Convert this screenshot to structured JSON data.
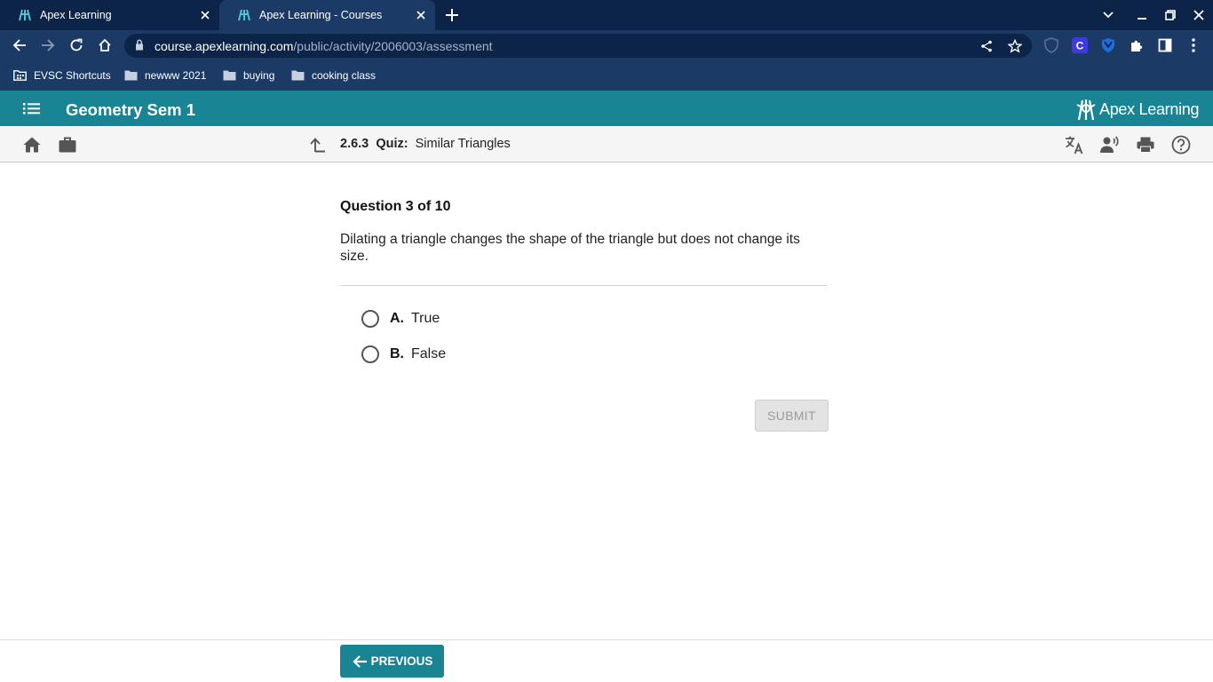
{
  "browser": {
    "tabs": [
      {
        "title": "Apex Learning",
        "active": false
      },
      {
        "title": "Apex Learning - Courses",
        "active": true
      }
    ],
    "url_host": "course.apexlearning.com",
    "url_path": "/public/activity/2006003/assessment",
    "bookmarks": [
      {
        "label": "EVSC Shortcuts"
      },
      {
        "label": "newww 2021"
      },
      {
        "label": "buying"
      },
      {
        "label": "cooking class"
      }
    ]
  },
  "app": {
    "course_title": "Geometry Sem 1",
    "brand": "Apex Learning",
    "accent_color": "#198494"
  },
  "breadcrumb": {
    "number": "2.6.3",
    "kind": "Quiz:",
    "title": "Similar Triangles"
  },
  "question": {
    "counter": "Question 3 of 10",
    "text": "Dilating a triangle changes the shape of the triangle but does not change its size.",
    "choices": [
      {
        "letter": "A.",
        "text": "True"
      },
      {
        "letter": "B.",
        "text": "False"
      }
    ],
    "submit_label": "SUBMIT"
  },
  "footer": {
    "previous_label": "PREVIOUS"
  }
}
